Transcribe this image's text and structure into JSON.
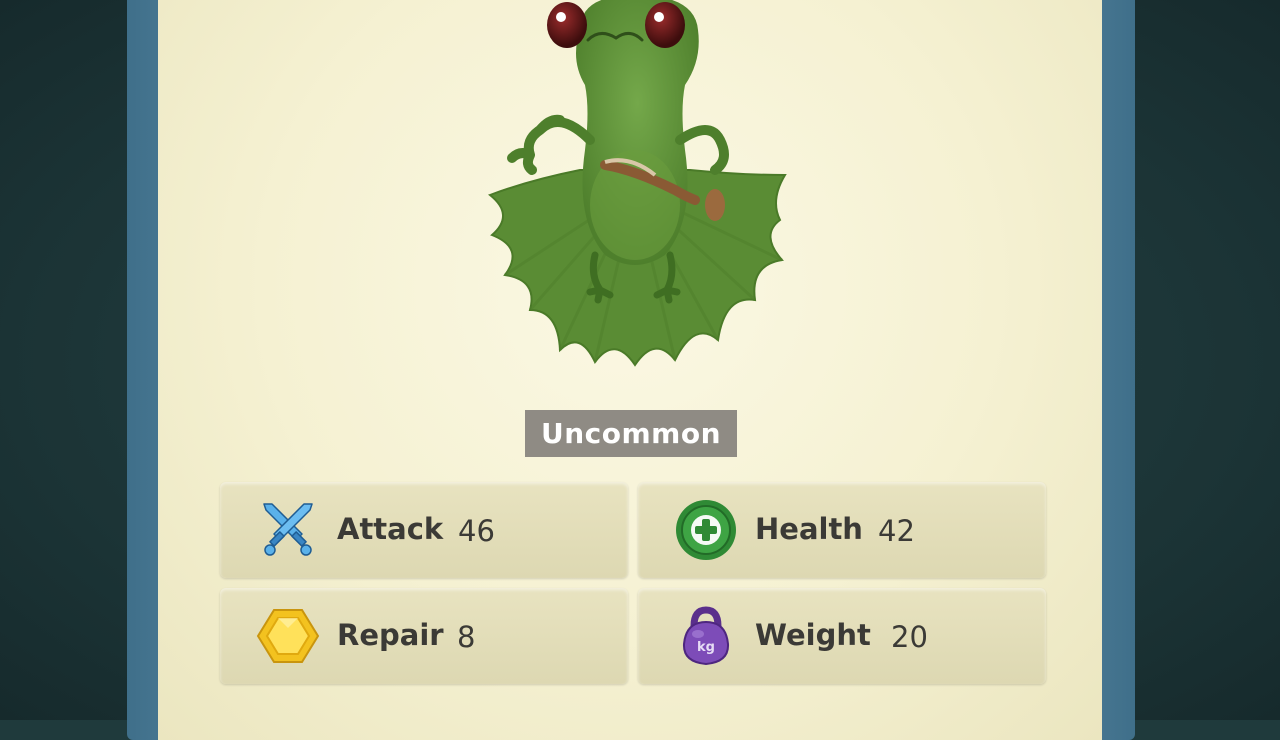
{
  "card": {
    "rarity": "Uncommon",
    "creature_icon": "green-winged-creature"
  },
  "stats": {
    "attack": {
      "label": "Attack",
      "value": "46",
      "icon": "crossed-swords-icon"
    },
    "health": {
      "label": "Health",
      "value": "42",
      "icon": "health-cross-icon"
    },
    "repair": {
      "label": "Repair",
      "value": "8",
      "icon": "gold-hexagon-icon"
    },
    "weight": {
      "label": "Weight",
      "value": "20",
      "icon": "kettlebell-icon"
    }
  },
  "colors": {
    "creature_green": "#5a8c34",
    "rarity_badge": "#8f8b84",
    "frame_blue": "#4b7c97",
    "card_bg": "#f5f1d2",
    "stat_box_bg": "#e2ddb8",
    "health_green": "#2f8a35",
    "repair_gold": "#f3c21f",
    "weight_purple": "#6a3fa0",
    "attack_blue": "#4a9fdc"
  }
}
